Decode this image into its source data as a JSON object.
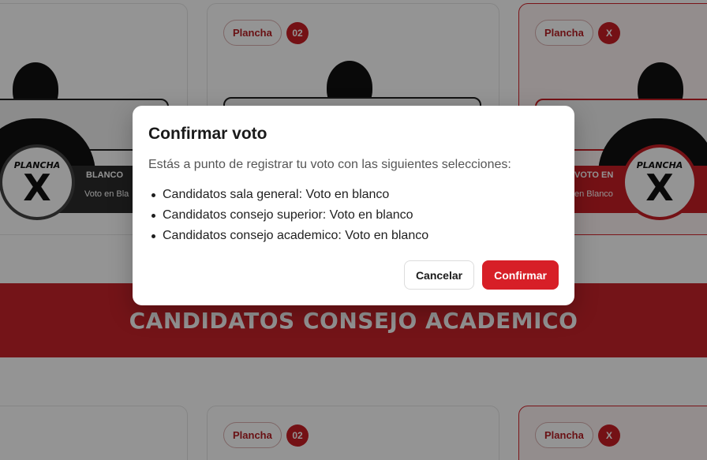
{
  "cards_top": [
    {
      "plancha_label": "Plancha",
      "number": "",
      "plate_text": "BLANCO",
      "plate_sub": "Voto en Bla",
      "badge_title": "PLANCHA",
      "badge_mark": "X"
    },
    {
      "plancha_label": "Plancha",
      "number": "02"
    },
    {
      "plancha_label": "Plancha",
      "number": "X",
      "plate_text": "VOTO EN",
      "plate_sub": "en Blanco",
      "badge_title": "PLANCHA",
      "badge_mark": "X"
    }
  ],
  "section": {
    "title": "CANDIDATOS CONSEJO ACADEMICO"
  },
  "cards_bottom": [
    {
      "plancha_label": "Plancha",
      "number": "02"
    },
    {
      "plancha_label": "Plancha",
      "number": "X"
    }
  ],
  "modal": {
    "title": "Confirmar voto",
    "description": "Estás a punto de registrar tu voto con las siguientes selecciones:",
    "selections": [
      "Candidatos sala general: Voto en blanco",
      "Candidatos consejo superior: Voto en blanco",
      "Candidatos consejo academico: Voto en blanco"
    ],
    "cancel_label": "Cancelar",
    "confirm_label": "Confirmar"
  },
  "colors": {
    "accent": "#d71f27",
    "section_band": "#c8232a"
  }
}
